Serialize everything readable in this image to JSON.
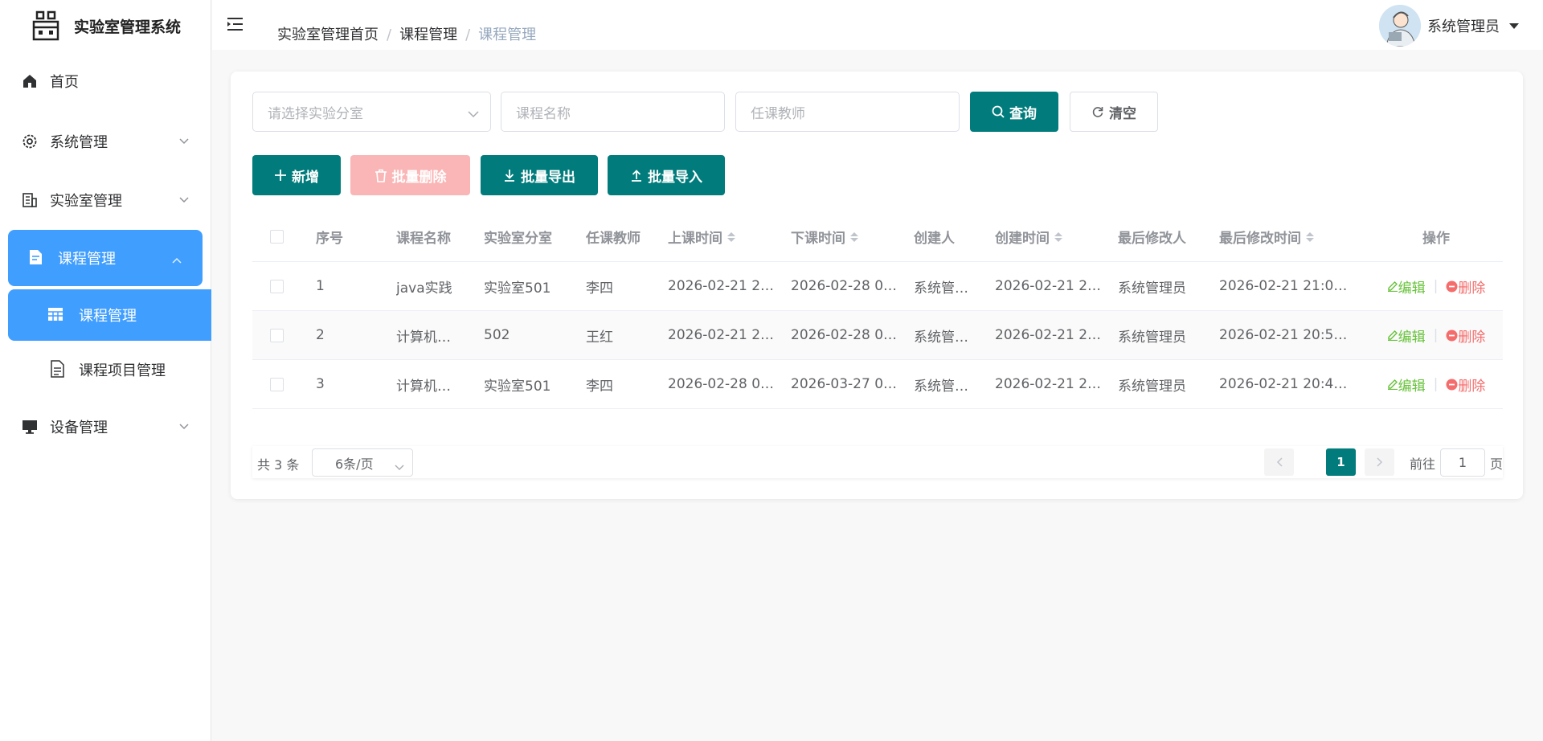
{
  "app": {
    "title": "实验室管理系统"
  },
  "sidebar": {
    "items": [
      {
        "label": "首页"
      },
      {
        "label": "系统管理"
      },
      {
        "label": "实验室管理"
      },
      {
        "label": "课程管理"
      },
      {
        "label": "课程管理"
      },
      {
        "label": "课程项目管理"
      },
      {
        "label": "设备管理"
      }
    ]
  },
  "header": {
    "breadcrumb": [
      "实验室管理首页",
      "课程管理",
      "课程管理"
    ],
    "breadcrumb_sep": "/",
    "user_name": "系统管理员"
  },
  "filters": {
    "lab_placeholder": "请选择实验分室",
    "course_placeholder": "课程名称",
    "teacher_placeholder": "任课教师",
    "search_label": "查询",
    "clear_label": "清空"
  },
  "toolbar": {
    "add_label": "新增",
    "batch_delete_label": "批量删除",
    "export_label": "批量导出",
    "import_label": "批量导入"
  },
  "table": {
    "headers": [
      "序号",
      "课程名称",
      "实验室分室",
      "任课教师",
      "上课时间",
      "下课时间",
      "创建人",
      "创建时间",
      "最后修改人",
      "最后修改时间",
      "操作"
    ],
    "rows": [
      [
        "1",
        "java实践",
        "实验室501",
        "李四",
        "2026-02-21 2…",
        "2026-02-28 0…",
        "系统管…",
        "2026-02-21 2…",
        "系统管理员",
        "2026-02-21 21:0…"
      ],
      [
        "2",
        "计算机…",
        "502",
        "王红",
        "2026-02-21 2…",
        "2026-02-28 0…",
        "系统管…",
        "2026-02-21 2…",
        "系统管理员",
        "2026-02-21 20:5…"
      ],
      [
        "3",
        "计算机…",
        "实验室501",
        "李四",
        "2026-02-28 0…",
        "2026-03-27 0…",
        "系统管…",
        "2026-02-21 2…",
        "系统管理员",
        "2026-02-21 20:4…"
      ]
    ],
    "edit_label": "编辑",
    "delete_label": "删除",
    "op_sep": "|"
  },
  "pagination": {
    "total_text": "共 3 条",
    "page_size": "6条/页",
    "current_page": "1",
    "goto_prefix": "前往",
    "goto_value": "1",
    "goto_suffix": "页"
  },
  "colors": {
    "primary": "#017b7b",
    "menu_active": "#409eff",
    "edit": "#67c23a",
    "delete": "#f56c6c",
    "disabled_danger": "#fab6b6"
  }
}
